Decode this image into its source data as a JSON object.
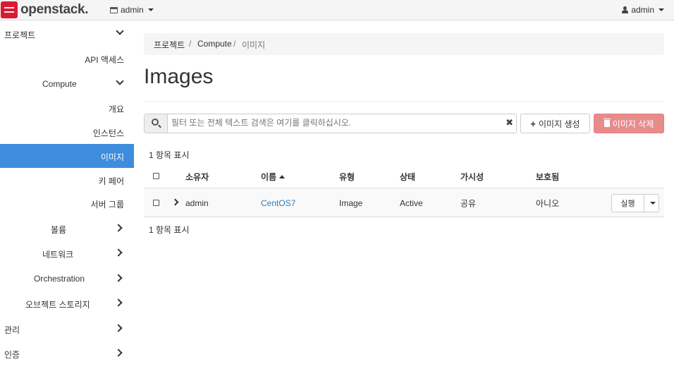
{
  "topbar": {
    "logo_text": "openstack.",
    "project": "admin",
    "user": "admin"
  },
  "sidebar": {
    "items": [
      {
        "label": "프로젝트",
        "level": 0,
        "expander": "down"
      },
      {
        "label": "API 액세스",
        "level": 2
      },
      {
        "label": "Compute",
        "level": 1,
        "expander": "down"
      },
      {
        "label": "개요",
        "level": 2
      },
      {
        "label": "인스턴스",
        "level": 2
      },
      {
        "label": "이미지",
        "level": 2,
        "active": true
      },
      {
        "label": "키 페어",
        "level": 2
      },
      {
        "label": "서버 그룹",
        "level": 2
      },
      {
        "label": "볼륨",
        "level": 1,
        "expander": "right"
      },
      {
        "label": "네트워크",
        "level": 1,
        "expander": "right"
      },
      {
        "label": "Orchestration",
        "level": 1,
        "expander": "right"
      },
      {
        "label": "오브젝트 스토리지",
        "level": 1,
        "expander": "right"
      },
      {
        "label": "관리",
        "level": 0,
        "expander": "right"
      },
      {
        "label": "인증",
        "level": 0,
        "expander": "right"
      }
    ]
  },
  "breadcrumb": [
    "프로젝트",
    "Compute",
    "이미지"
  ],
  "breadcrumb_sep": "/",
  "page_title": "Images",
  "search": {
    "placeholder": "필터 또는 전체 텍스트 검색은 여기를 클릭하십시오.",
    "clear_glyph": "✖"
  },
  "actions": {
    "create_label": "이미지 생성",
    "delete_label": "이미지 삭제"
  },
  "table": {
    "count_top": "1 항목 표시",
    "count_bottom": "1 항목 표시",
    "columns": [
      "소유자",
      "이름",
      "유형",
      "상태",
      "가시성",
      "보호됨"
    ],
    "sorted_column": "이름",
    "rows": [
      {
        "owner": "admin",
        "name": "CentOS7",
        "type": "Image",
        "status": "Active",
        "visibility": "공유",
        "protected": "아니오",
        "action": "실행"
      }
    ]
  },
  "colors": {
    "active_nav": "#3e8ddd",
    "danger_button": "#e88b8b",
    "link": "#337ab7",
    "logo": "#da1a32"
  }
}
